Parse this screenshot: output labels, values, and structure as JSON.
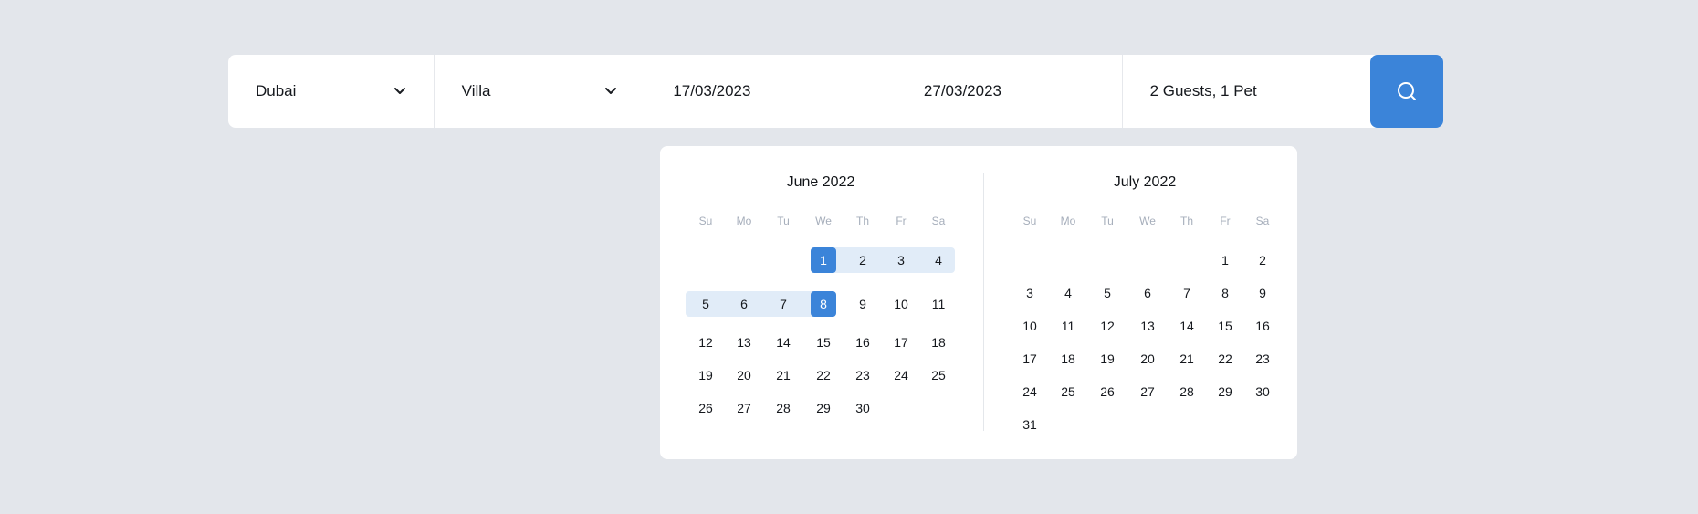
{
  "search": {
    "location": "Dubai",
    "property_type": "Villa",
    "check_in": "17/03/2023",
    "check_out": "27/03/2023",
    "guests": "2 Guests, 1 Pet"
  },
  "icons": {
    "dropdown": "chevron-down-icon",
    "search": "search-icon"
  },
  "colors": {
    "background": "#e3e6eb",
    "accent": "#3b84d9",
    "range": "#e1ecf8",
    "weekday": "#a6aebb"
  },
  "calendar": {
    "weekdays": [
      "Su",
      "Mo",
      "Tu",
      "We",
      "Th",
      "Fr",
      "Sa"
    ],
    "months": [
      {
        "title": "June 2022",
        "first_weekday": 3,
        "days": 30,
        "selected": [
          1,
          8
        ],
        "range_days": [
          1,
          2,
          3,
          4,
          5,
          6,
          7,
          8
        ]
      },
      {
        "title": "July 2022",
        "first_weekday": 5,
        "days": 31,
        "selected": [],
        "range_days": []
      }
    ]
  }
}
